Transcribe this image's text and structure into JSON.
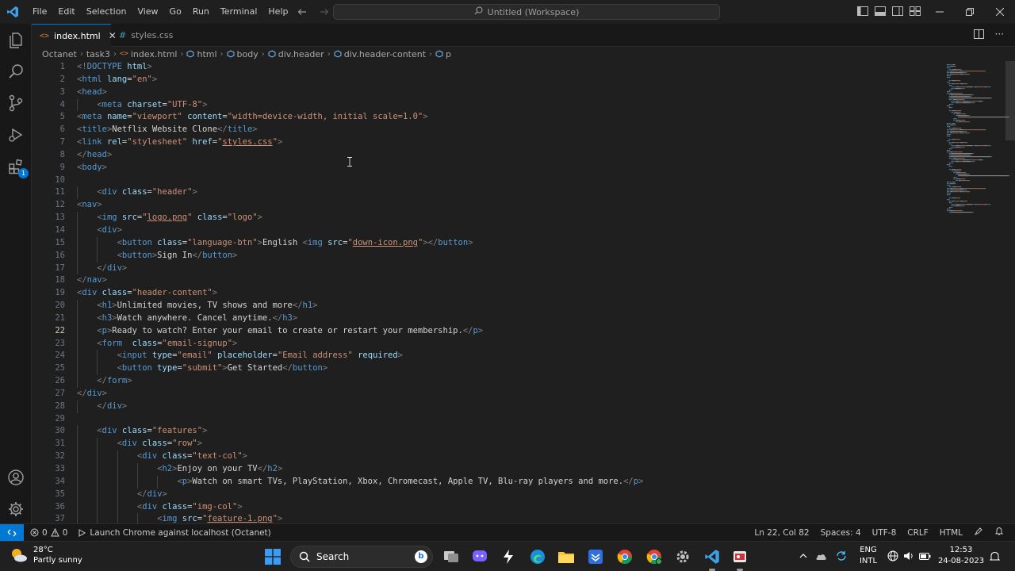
{
  "menu": [
    "File",
    "Edit",
    "Selection",
    "View",
    "Go",
    "Run",
    "Terminal",
    "Help"
  ],
  "command_center": "Untitled (Workspace)",
  "tabs": [
    {
      "label": "index.html",
      "active": true
    },
    {
      "label": "styles.css",
      "active": false
    }
  ],
  "breadcrumb": [
    "Octanet",
    "task3",
    "index.html",
    "html",
    "body",
    "div.header",
    "div.header-content",
    "p"
  ],
  "editor": {
    "current_line": 22,
    "lines": [
      [
        [
          "br",
          "<!"
        ],
        [
          "tag",
          "DOCTYPE"
        ],
        [
          "txt",
          " "
        ],
        [
          "attr",
          "html"
        ],
        [
          "br",
          ">"
        ]
      ],
      [
        [
          "br",
          "<"
        ],
        [
          "tag",
          "html"
        ],
        [
          "txt",
          " "
        ],
        [
          "attr",
          "lang"
        ],
        [
          "txt",
          "="
        ],
        [
          "str",
          "\"en\""
        ],
        [
          "br",
          ">"
        ]
      ],
      [
        [
          "br",
          "<"
        ],
        [
          "tag",
          "head"
        ],
        [
          "br",
          ">"
        ]
      ],
      [
        [
          "txt",
          "    "
        ],
        [
          "br",
          "<"
        ],
        [
          "tag",
          "meta"
        ],
        [
          "txt",
          " "
        ],
        [
          "attr",
          "charset"
        ],
        [
          "txt",
          "="
        ],
        [
          "str",
          "\"UTF-8\""
        ],
        [
          "br",
          ">"
        ]
      ],
      [
        [
          "br",
          "<"
        ],
        [
          "tag",
          "meta"
        ],
        [
          "txt",
          " "
        ],
        [
          "attr",
          "name"
        ],
        [
          "txt",
          "="
        ],
        [
          "str",
          "\"viewport\""
        ],
        [
          "txt",
          " "
        ],
        [
          "attr",
          "content"
        ],
        [
          "txt",
          "="
        ],
        [
          "str",
          "\"width=device-width, initial scale=1.0\""
        ],
        [
          "br",
          ">"
        ]
      ],
      [
        [
          "br",
          "<"
        ],
        [
          "tag",
          "title"
        ],
        [
          "br",
          ">"
        ],
        [
          "txt",
          "Netflix Website Clone"
        ],
        [
          "br",
          "</"
        ],
        [
          "tag",
          "title"
        ],
        [
          "br",
          ">"
        ]
      ],
      [
        [
          "br",
          "<"
        ],
        [
          "tag",
          "link"
        ],
        [
          "txt",
          " "
        ],
        [
          "attr",
          "rel"
        ],
        [
          "txt",
          "="
        ],
        [
          "str",
          "\"stylesheet\""
        ],
        [
          "txt",
          " "
        ],
        [
          "attr",
          "href"
        ],
        [
          "txt",
          "="
        ],
        [
          "str",
          "\""
        ],
        [
          "link",
          "styles.css"
        ],
        [
          "str",
          "\""
        ],
        [
          "br",
          ">"
        ]
      ],
      [
        [
          "br",
          "</"
        ],
        [
          "tag",
          "head"
        ],
        [
          "br",
          ">"
        ]
      ],
      [
        [
          "br",
          "<"
        ],
        [
          "tag",
          "body"
        ],
        [
          "br",
          ">"
        ]
      ],
      [],
      [
        [
          "txt",
          "    "
        ],
        [
          "br",
          "<"
        ],
        [
          "tag",
          "div"
        ],
        [
          "txt",
          " "
        ],
        [
          "attr",
          "class"
        ],
        [
          "txt",
          "="
        ],
        [
          "str",
          "\"header\""
        ],
        [
          "br",
          ">"
        ]
      ],
      [
        [
          "br",
          "<"
        ],
        [
          "tag",
          "nav"
        ],
        [
          "br",
          ">"
        ]
      ],
      [
        [
          "txt",
          "    "
        ],
        [
          "br",
          "<"
        ],
        [
          "tag",
          "img"
        ],
        [
          "txt",
          " "
        ],
        [
          "attr",
          "src"
        ],
        [
          "txt",
          "="
        ],
        [
          "str",
          "\""
        ],
        [
          "link",
          "logo.png"
        ],
        [
          "str",
          "\""
        ],
        [
          "txt",
          " "
        ],
        [
          "attr",
          "class"
        ],
        [
          "txt",
          "="
        ],
        [
          "str",
          "\"logo\""
        ],
        [
          "br",
          ">"
        ]
      ],
      [
        [
          "txt",
          "    "
        ],
        [
          "br",
          "<"
        ],
        [
          "tag",
          "div"
        ],
        [
          "br",
          ">"
        ]
      ],
      [
        [
          "txt",
          "        "
        ],
        [
          "br",
          "<"
        ],
        [
          "tag",
          "button"
        ],
        [
          "txt",
          " "
        ],
        [
          "attr",
          "class"
        ],
        [
          "txt",
          "="
        ],
        [
          "str",
          "\"language-btn\""
        ],
        [
          "br",
          ">"
        ],
        [
          "txt",
          "English "
        ],
        [
          "br",
          "<"
        ],
        [
          "tag",
          "img"
        ],
        [
          "txt",
          " "
        ],
        [
          "attr",
          "src"
        ],
        [
          "txt",
          "="
        ],
        [
          "str",
          "\""
        ],
        [
          "link",
          "down-icon.png"
        ],
        [
          "str",
          "\""
        ],
        [
          "br",
          "></"
        ],
        [
          "tag",
          "button"
        ],
        [
          "br",
          ">"
        ]
      ],
      [
        [
          "txt",
          "        "
        ],
        [
          "br",
          "<"
        ],
        [
          "tag",
          "button"
        ],
        [
          "br",
          ">"
        ],
        [
          "txt",
          "Sign In"
        ],
        [
          "br",
          "</"
        ],
        [
          "tag",
          "button"
        ],
        [
          "br",
          ">"
        ]
      ],
      [
        [
          "txt",
          "    "
        ],
        [
          "br",
          "</"
        ],
        [
          "tag",
          "div"
        ],
        [
          "br",
          ">"
        ]
      ],
      [
        [
          "br",
          "</"
        ],
        [
          "tag",
          "nav"
        ],
        [
          "br",
          ">"
        ]
      ],
      [
        [
          "br",
          "<"
        ],
        [
          "tag",
          "div"
        ],
        [
          "txt",
          " "
        ],
        [
          "attr",
          "class"
        ],
        [
          "txt",
          "="
        ],
        [
          "str",
          "\"header-content\""
        ],
        [
          "br",
          ">"
        ]
      ],
      [
        [
          "txt",
          "    "
        ],
        [
          "br",
          "<"
        ],
        [
          "tag",
          "h1"
        ],
        [
          "br",
          ">"
        ],
        [
          "txt",
          "Unlimited movies, TV shows and more"
        ],
        [
          "br",
          "</"
        ],
        [
          "tag",
          "h1"
        ],
        [
          "br",
          ">"
        ]
      ],
      [
        [
          "txt",
          "    "
        ],
        [
          "br",
          "<"
        ],
        [
          "tag",
          "h3"
        ],
        [
          "br",
          ">"
        ],
        [
          "txt",
          "Watch anywhere. Cancel anytime."
        ],
        [
          "br",
          "</"
        ],
        [
          "tag",
          "h3"
        ],
        [
          "br",
          ">"
        ]
      ],
      [
        [
          "txt",
          "    "
        ],
        [
          "br",
          "<"
        ],
        [
          "tag",
          "p"
        ],
        [
          "br",
          ">"
        ],
        [
          "txt",
          "Ready to watch? Enter your email to create or restart your membership."
        ],
        [
          "br",
          "</"
        ],
        [
          "tag",
          "p"
        ],
        [
          "br",
          ">"
        ]
      ],
      [
        [
          "txt",
          "    "
        ],
        [
          "br",
          "<"
        ],
        [
          "tag",
          "form"
        ],
        [
          "txt",
          "  "
        ],
        [
          "attr",
          "class"
        ],
        [
          "txt",
          "="
        ],
        [
          "str",
          "\"email-signup\""
        ],
        [
          "br",
          ">"
        ]
      ],
      [
        [
          "txt",
          "        "
        ],
        [
          "br",
          "<"
        ],
        [
          "tag",
          "input"
        ],
        [
          "txt",
          " "
        ],
        [
          "attr",
          "type"
        ],
        [
          "txt",
          "="
        ],
        [
          "str",
          "\"email\""
        ],
        [
          "txt",
          " "
        ],
        [
          "attr",
          "placeholder"
        ],
        [
          "txt",
          "="
        ],
        [
          "str",
          "\"Email address\""
        ],
        [
          "txt",
          " "
        ],
        [
          "attr",
          "required"
        ],
        [
          "br",
          ">"
        ]
      ],
      [
        [
          "txt",
          "        "
        ],
        [
          "br",
          "<"
        ],
        [
          "tag",
          "button"
        ],
        [
          "txt",
          " "
        ],
        [
          "attr",
          "type"
        ],
        [
          "txt",
          "="
        ],
        [
          "str",
          "\"submit\""
        ],
        [
          "br",
          ">"
        ],
        [
          "txt",
          "Get Started"
        ],
        [
          "br",
          "</"
        ],
        [
          "tag",
          "button"
        ],
        [
          "br",
          ">"
        ]
      ],
      [
        [
          "txt",
          "    "
        ],
        [
          "br",
          "</"
        ],
        [
          "tag",
          "form"
        ],
        [
          "br",
          ">"
        ]
      ],
      [
        [
          "br",
          "</"
        ],
        [
          "tag",
          "div"
        ],
        [
          "br",
          ">"
        ]
      ],
      [
        [
          "txt",
          "    "
        ],
        [
          "br",
          "</"
        ],
        [
          "tag",
          "div"
        ],
        [
          "br",
          ">"
        ]
      ],
      [],
      [
        [
          "txt",
          "    "
        ],
        [
          "br",
          "<"
        ],
        [
          "tag",
          "div"
        ],
        [
          "txt",
          " "
        ],
        [
          "attr",
          "class"
        ],
        [
          "txt",
          "="
        ],
        [
          "str",
          "\"features\""
        ],
        [
          "br",
          ">"
        ]
      ],
      [
        [
          "txt",
          "        "
        ],
        [
          "br",
          "<"
        ],
        [
          "tag",
          "div"
        ],
        [
          "txt",
          " "
        ],
        [
          "attr",
          "class"
        ],
        [
          "txt",
          "="
        ],
        [
          "str",
          "\"row\""
        ],
        [
          "br",
          ">"
        ]
      ],
      [
        [
          "txt",
          "            "
        ],
        [
          "br",
          "<"
        ],
        [
          "tag",
          "div"
        ],
        [
          "txt",
          " "
        ],
        [
          "attr",
          "class"
        ],
        [
          "txt",
          "="
        ],
        [
          "str",
          "\"text-col\""
        ],
        [
          "br",
          ">"
        ]
      ],
      [
        [
          "txt",
          "                "
        ],
        [
          "br",
          "<"
        ],
        [
          "tag",
          "h2"
        ],
        [
          "br",
          ">"
        ],
        [
          "txt",
          "Enjoy on your TV"
        ],
        [
          "br",
          "</"
        ],
        [
          "tag",
          "h2"
        ],
        [
          "br",
          ">"
        ]
      ],
      [
        [
          "txt",
          "                    "
        ],
        [
          "br",
          "<"
        ],
        [
          "tag",
          "p"
        ],
        [
          "br",
          ">"
        ],
        [
          "txt",
          "Watch on smart TVs, PlayStation, Xbox, Chromecast, Apple TV, Blu-ray players and more."
        ],
        [
          "br",
          "</"
        ],
        [
          "tag",
          "p"
        ],
        [
          "br",
          ">"
        ]
      ],
      [
        [
          "txt",
          "            "
        ],
        [
          "br",
          "</"
        ],
        [
          "tag",
          "div"
        ],
        [
          "br",
          ">"
        ]
      ],
      [
        [
          "txt",
          "            "
        ],
        [
          "br",
          "<"
        ],
        [
          "tag",
          "div"
        ],
        [
          "txt",
          " "
        ],
        [
          "attr",
          "class"
        ],
        [
          "txt",
          "="
        ],
        [
          "str",
          "\"img-col\""
        ],
        [
          "br",
          ">"
        ]
      ],
      [
        [
          "txt",
          "                "
        ],
        [
          "br",
          "<"
        ],
        [
          "tag",
          "img"
        ],
        [
          "txt",
          " "
        ],
        [
          "attr",
          "src"
        ],
        [
          "txt",
          "="
        ],
        [
          "str",
          "\""
        ],
        [
          "link",
          "feature-1.png"
        ],
        [
          "str",
          "\""
        ],
        [
          "br",
          ">"
        ]
      ]
    ]
  },
  "statusbar": {
    "errors": "0",
    "warnings": "0",
    "launch": "Launch Chrome against localhost (Octanet)",
    "position": "Ln 22, Col 82",
    "spaces": "Spaces: 4",
    "encoding": "UTF-8",
    "eol": "CRLF",
    "language": "HTML"
  },
  "taskbar": {
    "temperature": "28°C",
    "weather": "Partly sunny",
    "search_label": "Search",
    "lang_top": "ENG",
    "lang_bottom": "INTL",
    "time": "12:53",
    "date": "24-08-2023"
  },
  "colors": {
    "accent": "#0078d4",
    "tag": "#569cd6",
    "attr": "#9cdcfe",
    "string": "#ce9178",
    "text": "#d4d4d4"
  }
}
